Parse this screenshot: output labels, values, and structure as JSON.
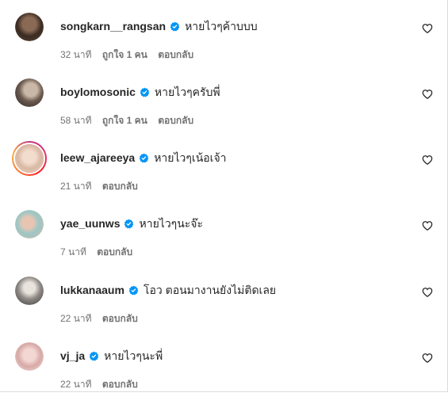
{
  "comments": [
    {
      "username": "songkarn__rangsan",
      "text": "หายไวๆค้าบบบ",
      "time": "32 นาที",
      "likes": "ถูกใจ 1 คน",
      "reply": "ตอบกลับ"
    },
    {
      "username": "boylomosonic",
      "text": "หายไวๆครับพี่",
      "time": "58 นาที",
      "likes": "ถูกใจ 1 คน",
      "reply": "ตอบกลับ"
    },
    {
      "username": "leew_ajareeya",
      "text": "หายไวๆเน้อเจ้า",
      "time": "21 นาที",
      "reply": "ตอบกลับ"
    },
    {
      "username": "yae_uunws",
      "text": "หายไวๆนะจ๊ะ",
      "time": "7 นาที",
      "reply": "ตอบกลับ"
    },
    {
      "username": "lukkanaaum",
      "text": "โอว ตอนมางานยังไม่ติดเลย",
      "time": "22 นาที",
      "reply": "ตอบกลับ"
    },
    {
      "username": "vj_ja",
      "text": "หายไวๆนะพี่",
      "time": "22 นาที",
      "reply": "ตอบกลับ"
    }
  ],
  "icons": {
    "verified": "verified-badge-icon",
    "like": "heart-outline-icon"
  },
  "colors": {
    "verified": "#0095f6",
    "muted": "#737373",
    "text": "#262626"
  }
}
